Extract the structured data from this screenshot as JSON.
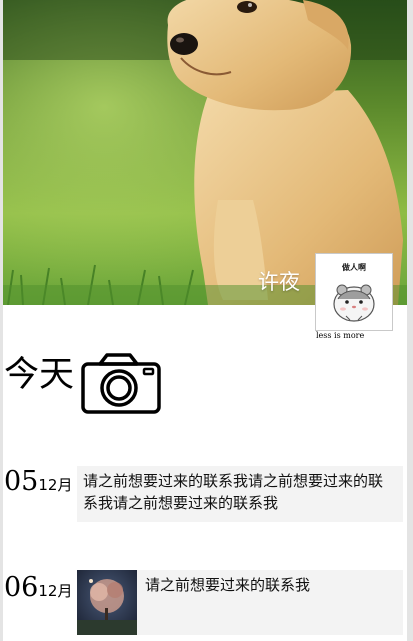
{
  "profile": {
    "nickname": "许夜",
    "avatar_caption": "做人啊",
    "motto": "less is more"
  },
  "today": {
    "label": "今天",
    "camera_icon": "camera-icon"
  },
  "posts": [
    {
      "day": "05",
      "month": "12月",
      "text": "请之前想要过来的联系我请之前想要过来的联系我请之前想要过来的联系我",
      "has_image": false
    },
    {
      "day": "06",
      "month": "12月",
      "text": "请之前想要过来的联系我",
      "has_image": true
    }
  ],
  "colors": {
    "page_bg": "#ffffff",
    "side_bg": "#e4e4e4",
    "post_bg": "#f3f3f3",
    "grass": "#6aa53a"
  }
}
